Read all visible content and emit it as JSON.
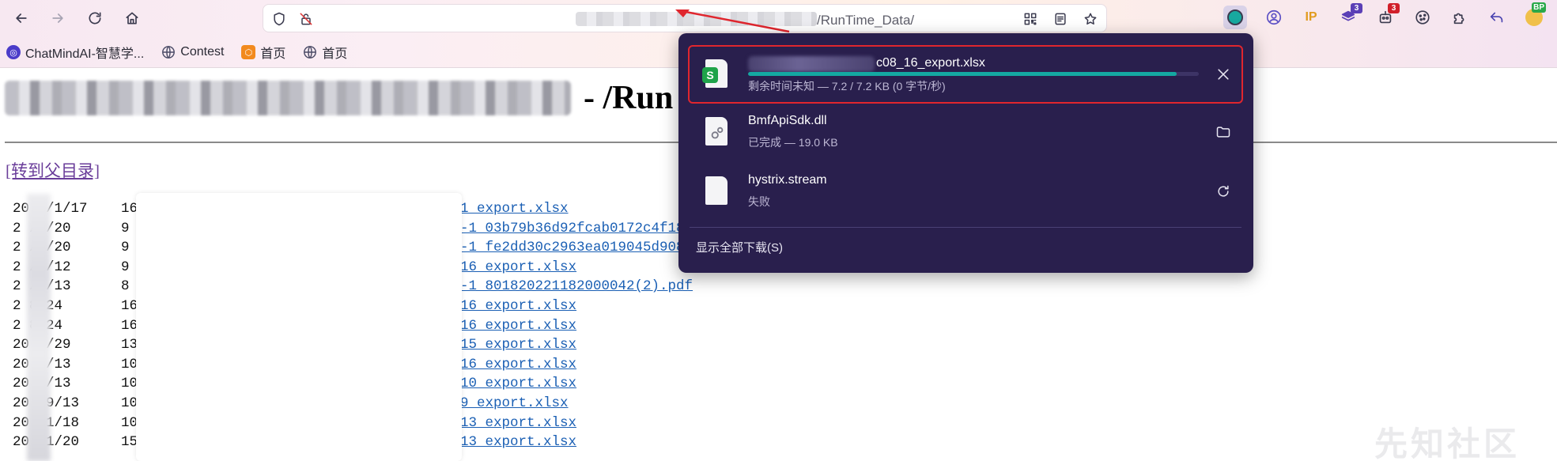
{
  "browser": {
    "url_visible": "/RunTime_Data/",
    "bookmarks": [
      {
        "label": "ChatMindAI-智慧学..."
      },
      {
        "label": "Contest"
      },
      {
        "label": "首页"
      },
      {
        "label": "首页"
      }
    ],
    "extensions": {
      "ext3_badge": "3",
      "ext4_badge": "3",
      "ip_label": "IP",
      "bp_label": "BP"
    }
  },
  "page": {
    "heading_suffix": "- /Run",
    "parent_link": "[转到父目录]",
    "rows": [
      {
        "date": "20 2/1/17",
        "size": "16",
        "name": "1_export.xlsx"
      },
      {
        "date": "2 /1/20",
        "size": "9",
        "name": "-1_03b79b36d92fcab0172c4f18"
      },
      {
        "date": "2 /1/20",
        "size": "9",
        "name": "-1_fe2dd30c2963ea019045d908"
      },
      {
        "date": "2 /8/12",
        "size": "9",
        "name": "16_export.xlsx"
      },
      {
        "date": "2 /8/13",
        "size": "8",
        "name": "-1_801820221182000042(2).pdf"
      },
      {
        "date": "2 8/24",
        "size": "16",
        "name": "16_export.xlsx"
      },
      {
        "date": "2 8/24",
        "size": "16",
        "name": "16_export.xlsx"
      },
      {
        "date": "20 8/29",
        "size": "13",
        "name": "15_export.xlsx"
      },
      {
        "date": "20 9/13",
        "size": "10",
        "name": "16_export.xlsx"
      },
      {
        "date": "20 9/13",
        "size": "10",
        "name": "10_export.xlsx"
      },
      {
        "date": "20 /9/13",
        "size": "10",
        "name": "9_export.xlsx"
      },
      {
        "date": "20 /1/18",
        "size": "10",
        "name": "13_export.xlsx"
      },
      {
        "date": "20 /1/20",
        "size": "15",
        "name": "13_export.xlsx"
      }
    ]
  },
  "downloads": {
    "items": [
      {
        "name": "c08_16_export.xlsx",
        "status": "剩余时间未知 — 7.2 / 7.2 KB (0 字节/秒)",
        "progress": 0.95,
        "icon": "spreadsheet-file-icon",
        "action": "close-icon"
      },
      {
        "name": "BmfApiSdk.dll",
        "status": "已完成 — 19.0 KB",
        "icon": "dll-file-icon",
        "action": "folder-icon"
      },
      {
        "name": "hystrix.stream",
        "status": "失败",
        "icon": "blank-file-icon",
        "action": "retry-icon"
      }
    ],
    "show_all": "显示全部下载(S)"
  },
  "watermark": "先知社区",
  "colors": {
    "panel_bg": "#291f4d",
    "progress_fill": "#14a8a2",
    "highlight_box": "#e0262e",
    "link": "#1a5fb4",
    "visited_link": "#6a3d9a"
  }
}
